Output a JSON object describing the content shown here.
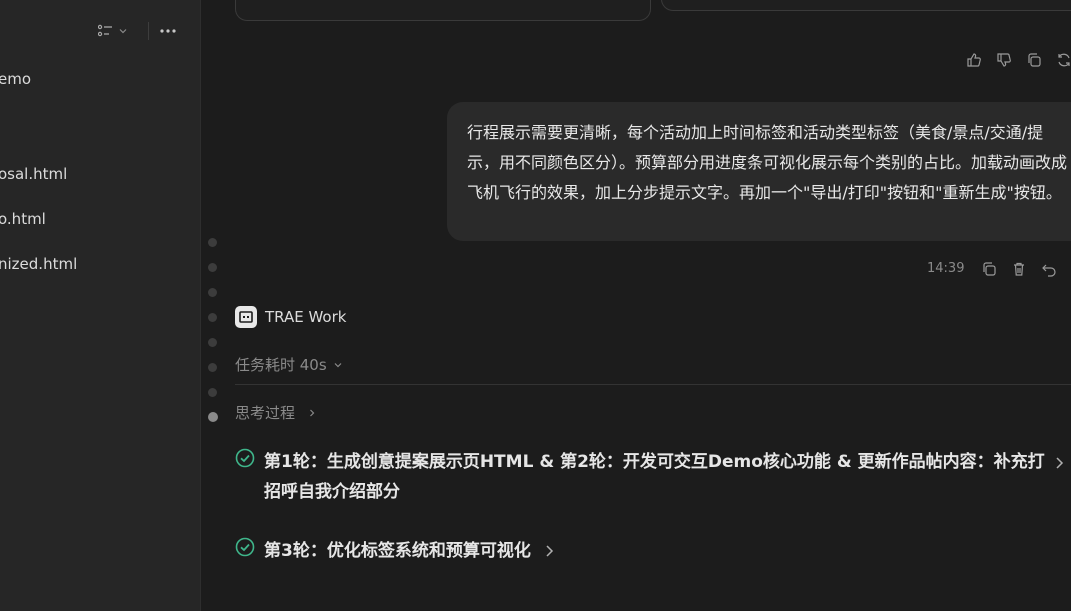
{
  "sidebar": {
    "items": [
      {
        "label": "emo"
      },
      {
        "label": "osal.html"
      },
      {
        "label": "o.html"
      },
      {
        "label": "nized.html"
      }
    ]
  },
  "conversation": {
    "user_message": "行程展示需要更清晰，每个活动加上时间标签和活动类型标签（美食/景点/交通/提示，用不同颜色区分）。预算部分用进度条可视化展示每个类别的占比。加载动画改成飞机飞行的效果，加上分步提示文字。再加一个\"导出/打印\"按钮和\"重新生成\"按钮。",
    "timestamp": "14:39"
  },
  "agent": {
    "name": "TRAE Work",
    "task_duration": "任务耗时 40s",
    "thinking_label": "思考过程",
    "steps": [
      {
        "text": "第1轮：生成创意提案展示页HTML & 第2轮：开发可交互Demo核心功能 & 更新作品帖内容：补充打招呼自我介绍部分",
        "status": "done"
      },
      {
        "text": "第3轮：优化标签系统和预算可视化",
        "status": "done"
      }
    ]
  },
  "colors": {
    "accent_green": "#3fb68b",
    "background": "#1c1c1c",
    "bubble": "#2a2a2a"
  }
}
